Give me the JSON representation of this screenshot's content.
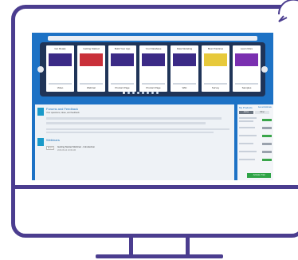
{
  "colors": {
    "frame": "#4b3d8f",
    "screen_bg": "#1d72c5",
    "carousel_bg": "#1f3458",
    "thumb": "#3b2a86",
    "accent": "#1a9ac9",
    "green": "#2ea346"
  },
  "carousel": {
    "cards": [
      {
        "title": "Get Ready",
        "label": "Video"
      },
      {
        "title": "Getting Started",
        "label": "Webinar"
      },
      {
        "title": "Build Your App",
        "label": "Product Page"
      },
      {
        "title": "Your Database",
        "label": "Product Page"
      },
      {
        "title": "Data Modeling",
        "label": "Wiki"
      },
      {
        "title": "Best Practices",
        "label": "Survey"
      },
      {
        "title": "Learn More",
        "label": "Samples"
      }
    ],
    "nav_left_icon": "chevron-left-icon",
    "nav_right_icon": "chevron-right-icon",
    "dot_count": 8,
    "active_dot": 0
  },
  "main": {
    "forums_title": "Forums and Feedback",
    "forums_sub": "Your questions, ideas, and feedback",
    "webinars_title": "Webinars",
    "webinar_button": "Event",
    "webinar_title": "Getting Started Webinar - Introduction",
    "webinar_date": "2016-09-14 10:00 AM"
  },
  "sidebar": {
    "title": "My Products",
    "link": "Get an Estimate",
    "tab_active": "Active",
    "tab_other": "Other",
    "button": "Activate Trial"
  }
}
